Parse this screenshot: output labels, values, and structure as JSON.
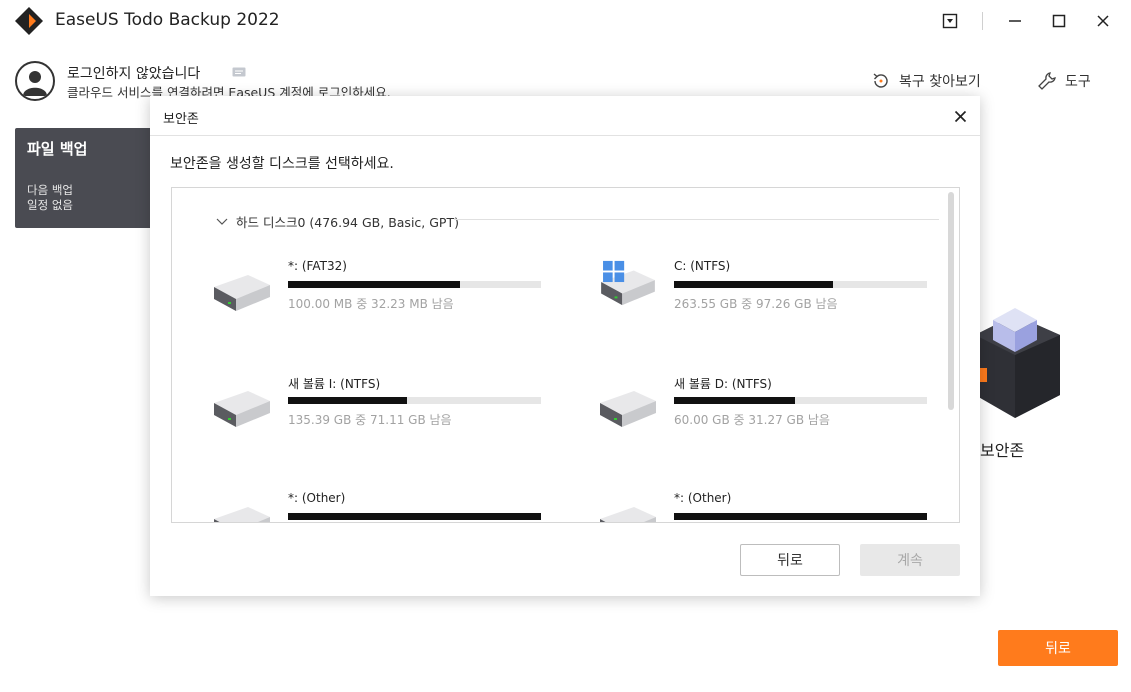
{
  "app": {
    "title": "EaseUS Todo Backup 2022"
  },
  "account": {
    "title": "로그인하지 않았습니다",
    "subtitle": "클라우드 서비스를 연결하려면 EaseUS 계정에 로그인하세요."
  },
  "top_links": {
    "restore": "복구 찾아보기",
    "tools": "도구"
  },
  "backup_card": {
    "title": "파일 백업",
    "line1": "다음 백업",
    "line2": "일정 없음"
  },
  "background": {
    "zone_label": "보안존",
    "back_button": "뒤로"
  },
  "dialog": {
    "title": "보안존",
    "prompt": "보안존을 생성할 디스크를 선택하세요.",
    "disk": {
      "label": "하드 디스크0 (476.94 GB, Basic, GPT)"
    },
    "partitions": [
      {
        "name": "*: (FAT32)",
        "usage": "100.00 MB 중 32.23 MB  남음",
        "used_fraction": 0.68,
        "icon": "drive-icon"
      },
      {
        "name": "C: (NTFS)",
        "usage": "263.55 GB 중 97.26 GB  남음",
        "used_fraction": 0.63,
        "icon": "windows-drive-icon"
      },
      {
        "name": "새 볼륨 I: (NTFS)",
        "usage": "135.39 GB 중 71.11 GB  남음",
        "used_fraction": 0.47,
        "icon": "drive-icon"
      },
      {
        "name": "새 볼륨 D: (NTFS)",
        "usage": "60.00 GB 중 31.27 GB  남음",
        "used_fraction": 0.48,
        "icon": "drive-icon"
      },
      {
        "name": "*: (Other)",
        "usage": "",
        "used_fraction": 1.0,
        "icon": "drive-icon"
      },
      {
        "name": "*: (Other)",
        "usage": "",
        "used_fraction": 1.0,
        "icon": "drive-icon"
      }
    ],
    "buttons": {
      "back": "뒤로",
      "next": "계속"
    }
  },
  "colors": {
    "accent": "#ff7b1c",
    "card": "#4a4b52"
  }
}
